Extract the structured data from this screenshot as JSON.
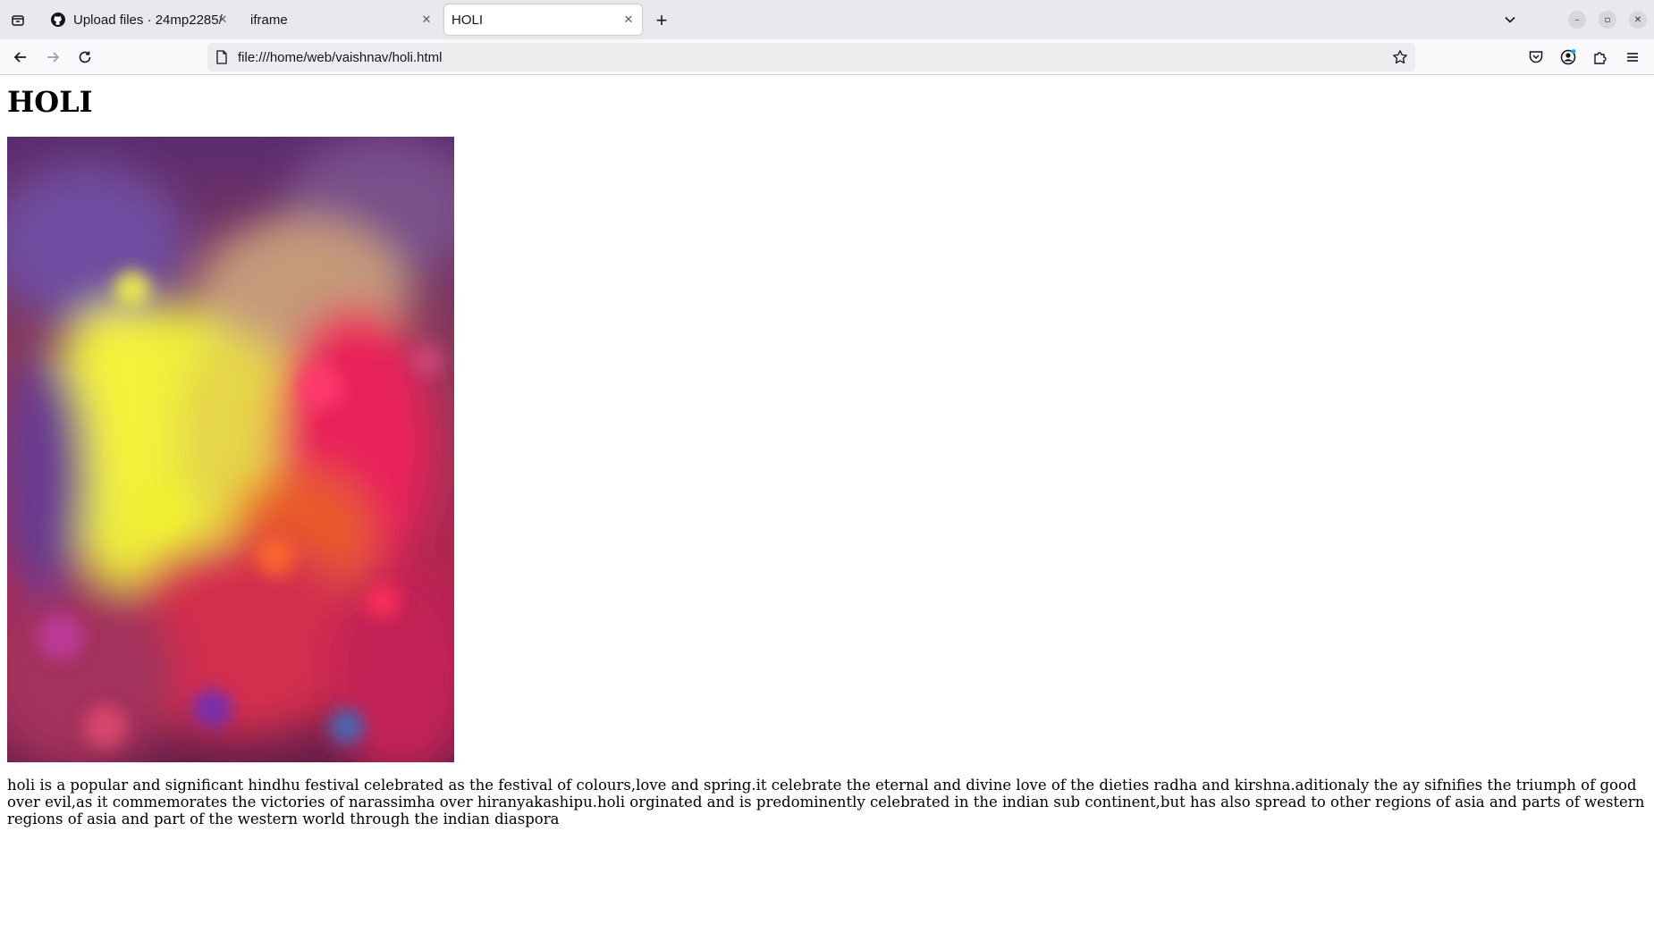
{
  "browser": {
    "tabs": [
      {
        "title": "Upload files · 24mp2285/",
        "icon": "github-icon",
        "active": false
      },
      {
        "title": "iframe",
        "icon": "none",
        "active": false
      },
      {
        "title": "HOLI",
        "icon": "none",
        "active": true
      }
    ],
    "url": "file:///home/web/vaishnav/holi.html",
    "window_controls": [
      "–",
      "▫",
      "✕"
    ]
  },
  "page": {
    "heading": "HOLI",
    "image": {
      "alt": "holi",
      "description_icon": "photo-of-holi-festival-crowd-with-colored-powder"
    },
    "paragraph": "holi is a popular and significant hindhu festival celebrated as the festival of colours,love and spring.it celebrate the eternal and divine love of the dieties radha and kirshna.aditionaly the ay sifnifies the triumph of good over evil,as it commemorates the victories of narassimha over hiranyakashipu.holi orginated and is predominently celebrated in the indian sub continent,but has also spread to other regions of asia and parts of western regions of asia and part of the western world through the indian diaspora"
  },
  "colors": {
    "tabstrip_bg": "#e8e8ed",
    "navbar_bg": "#f9f9fb",
    "urlbar_bg": "#ededf0",
    "accent_dot": "#00b3f4"
  }
}
